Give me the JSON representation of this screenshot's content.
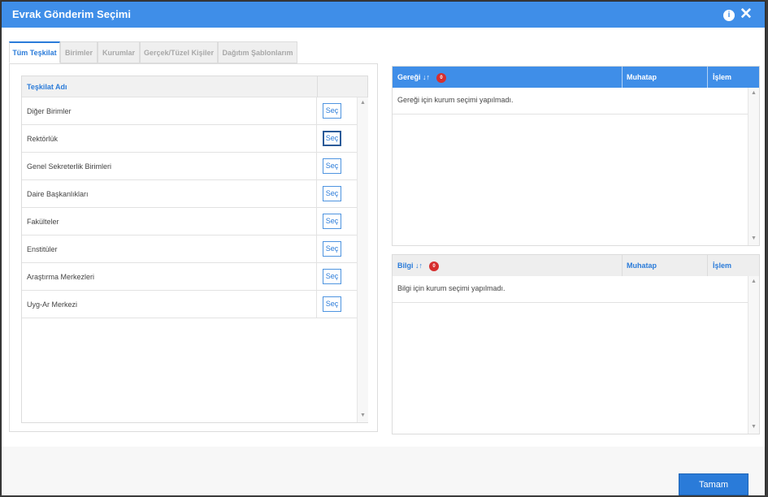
{
  "dialog": {
    "title": "Evrak Gönderim Seçimi",
    "info_glyph": "i",
    "close_glyph": "✕"
  },
  "tabs": [
    {
      "label": "Tüm Teşkilat"
    },
    {
      "label": "Birimler"
    },
    {
      "label": "Kurumlar"
    },
    {
      "label": "Gerçek/Tüzel Kişiler"
    },
    {
      "label": "Dağıtım Şablonlarım"
    }
  ],
  "org_table": {
    "header": "Teşkilat Adı",
    "select_label": "Seç",
    "rows": [
      {
        "name": "Diğer Birimler"
      },
      {
        "name": "Rektörlük"
      },
      {
        "name": "Genel Sekreterlik Birimleri"
      },
      {
        "name": "Daire Başkanlıkları"
      },
      {
        "name": "Fakülteler"
      },
      {
        "name": "Enstitüler"
      },
      {
        "name": "Araştırma Merkezleri"
      },
      {
        "name": "Uyg-Ar Merkezi"
      }
    ]
  },
  "geregi": {
    "header": "Gereği",
    "sort_glyph": "↓↑",
    "count": "0",
    "col_muhatap": "Muhatap",
    "col_islem": "İşlem",
    "empty_message": "Gereği için kurum seçimi yapılmadı."
  },
  "bilgi": {
    "header": "Bilgi",
    "sort_glyph": "↓↑",
    "count": "0",
    "col_muhatap": "Muhatap",
    "col_islem": "İşlem",
    "empty_message": "Bilgi için kurum seçimi yapılmadı."
  },
  "footer": {
    "ok_label": "Tamam"
  },
  "colors": {
    "accent": "#3f8ee8",
    "badge": "#d62f2f"
  }
}
